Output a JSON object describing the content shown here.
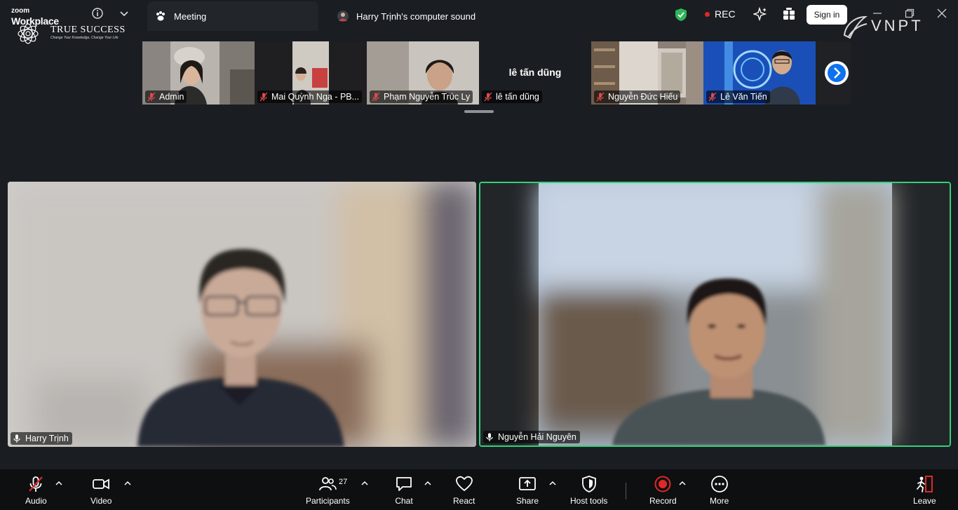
{
  "app": {
    "zoom_small": "zoom",
    "workplace": "Workplace",
    "brand_title": "TRUE SUCCESS",
    "brand_slogan": "Change Your Knowledge, Change Your Life"
  },
  "tabs": [
    {
      "label": "Meeting",
      "icon": "paw-icon"
    },
    {
      "label": "Harry Trịnh's computer sound",
      "icon": "avatar"
    }
  ],
  "header": {
    "rec_label": "REC",
    "signin_label": "Sign in",
    "watermark": "VNPT",
    "colors": {
      "rec": "#e02828",
      "shield": "#2fb65a",
      "active_speaker": "#33d17a"
    }
  },
  "thumbnails": [
    {
      "name": "Admin",
      "muted": true
    },
    {
      "name": "Mai Quỳnh Nga - PB...",
      "muted": true
    },
    {
      "name": "Phạm Nguyễn Trúc Ly",
      "muted": true
    },
    {
      "name": "lê tấn dũng",
      "big_name": "lê tấn dũng",
      "muted": true
    },
    {
      "name": "Nguyễn Đức Hiếu",
      "muted": true
    },
    {
      "name": "Lê Văn Tiến",
      "muted": true
    }
  ],
  "tiles": [
    {
      "name": "Harry Trịnh",
      "active": false
    },
    {
      "name": "Nguyễn Hải Nguyên",
      "active": true
    }
  ],
  "toolbar": {
    "audio": "Audio",
    "video": "Video",
    "participants": "Participants",
    "participant_count": "27",
    "chat": "Chat",
    "react": "React",
    "share": "Share",
    "host_tools": "Host tools",
    "record": "Record",
    "more": "More",
    "leave": "Leave"
  }
}
